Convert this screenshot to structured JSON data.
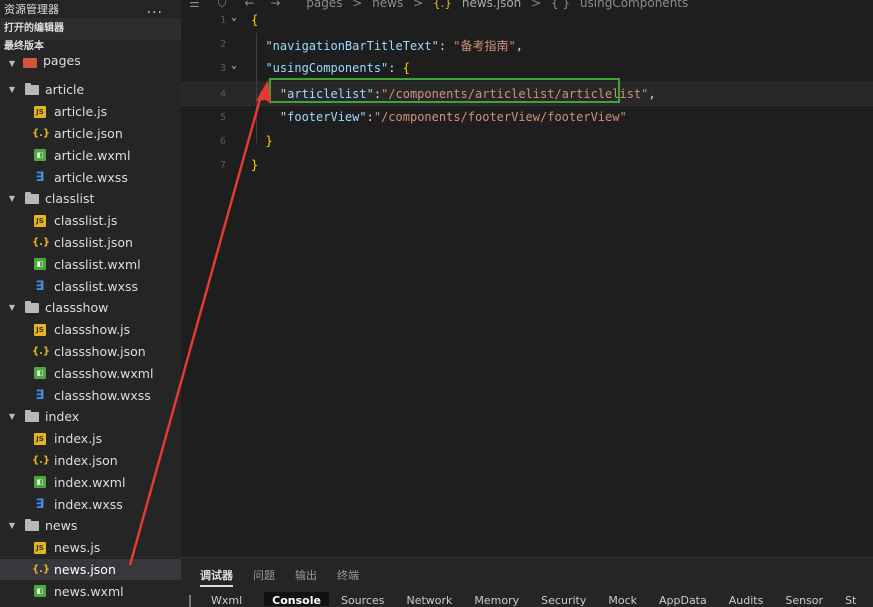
{
  "sidebar": {
    "title": "资源管理器",
    "more": "...",
    "open_editors": "打开的编辑器",
    "project": "最终版本",
    "root": "pages",
    "folders": [
      {
        "name": "article",
        "files": [
          {
            "name": "article.js",
            "type": "js"
          },
          {
            "name": "article.json",
            "type": "json"
          },
          {
            "name": "article.wxml",
            "type": "wxml"
          },
          {
            "name": "article.wxss",
            "type": "wxss"
          }
        ]
      },
      {
        "name": "classlist",
        "files": [
          {
            "name": "classlist.js",
            "type": "js"
          },
          {
            "name": "classlist.json",
            "type": "json"
          },
          {
            "name": "classlist.wxml",
            "type": "wxml"
          },
          {
            "name": "classlist.wxss",
            "type": "wxss"
          }
        ]
      },
      {
        "name": "classshow",
        "files": [
          {
            "name": "classshow.js",
            "type": "js"
          },
          {
            "name": "classshow.json",
            "type": "json"
          },
          {
            "name": "classshow.wxml",
            "type": "wxml"
          },
          {
            "name": "classshow.wxss",
            "type": "wxss"
          }
        ]
      },
      {
        "name": "index",
        "files": [
          {
            "name": "index.js",
            "type": "js"
          },
          {
            "name": "index.json",
            "type": "json"
          },
          {
            "name": "index.wxml",
            "type": "wxml"
          },
          {
            "name": "index.wxss",
            "type": "wxss"
          }
        ]
      },
      {
        "name": "news",
        "files": [
          {
            "name": "news.js",
            "type": "js"
          },
          {
            "name": "news.json",
            "type": "json",
            "selected": true
          },
          {
            "name": "news.wxml",
            "type": "wxml"
          }
        ]
      }
    ]
  },
  "breadcrumb": [
    "pages",
    ">",
    "news",
    ">",
    "{.}",
    "news.json",
    ">",
    "{ }",
    "usingComponents"
  ],
  "editor": {
    "lines": [
      {
        "num": "1",
        "fold": "⌄",
        "code": [
          {
            "t": "{",
            "c": "y"
          }
        ]
      },
      {
        "num": "2",
        "code": [
          {
            "t": "  ",
            "c": "p"
          },
          {
            "t": "\"navigationBarTitleText\"",
            "c": "k"
          },
          {
            "t": ": ",
            "c": "p"
          },
          {
            "t": "\"备考指南\"",
            "c": "s"
          },
          {
            "t": ",",
            "c": "p"
          }
        ]
      },
      {
        "num": "3",
        "fold": "⌄",
        "code": [
          {
            "t": "  ",
            "c": "p"
          },
          {
            "t": "\"usingComponents\"",
            "c": "k"
          },
          {
            "t": ": ",
            "c": "p"
          },
          {
            "t": "{",
            "c": "y"
          }
        ]
      },
      {
        "num": "4",
        "current": true,
        "code": [
          {
            "t": "    ",
            "c": "p"
          },
          {
            "t": "\"articlelist\"",
            "c": "k"
          },
          {
            "t": ":",
            "c": "p"
          },
          {
            "t": "\"/components/articlelist/articlelist\"",
            "c": "s"
          },
          {
            "t": ",",
            "c": "p"
          }
        ]
      },
      {
        "num": "5",
        "code": [
          {
            "t": "    ",
            "c": "p"
          },
          {
            "t": "\"footerView\"",
            "c": "k"
          },
          {
            "t": ":",
            "c": "p"
          },
          {
            "t": "\"/components/footerView/footerView\"",
            "c": "s"
          }
        ]
      },
      {
        "num": "6",
        "code": [
          {
            "t": "  ",
            "c": "p"
          },
          {
            "t": "}",
            "c": "y"
          }
        ]
      },
      {
        "num": "7",
        "code": [
          {
            "t": "}",
            "c": "y"
          }
        ]
      }
    ]
  },
  "bottom_panel": {
    "tabs": [
      "调试器",
      "问题",
      "输出",
      "终端"
    ],
    "active_tab": "调试器",
    "devtools_tabs": [
      "Wxml",
      "Console",
      "Sources",
      "Network",
      "Memory",
      "Security",
      "Mock",
      "AppData",
      "Audits",
      "Sensor",
      "St"
    ],
    "active_devtools_tab": "Console"
  },
  "colors": {
    "highlight_box": "#3fa435",
    "annotation_arrow": "#e53935"
  }
}
